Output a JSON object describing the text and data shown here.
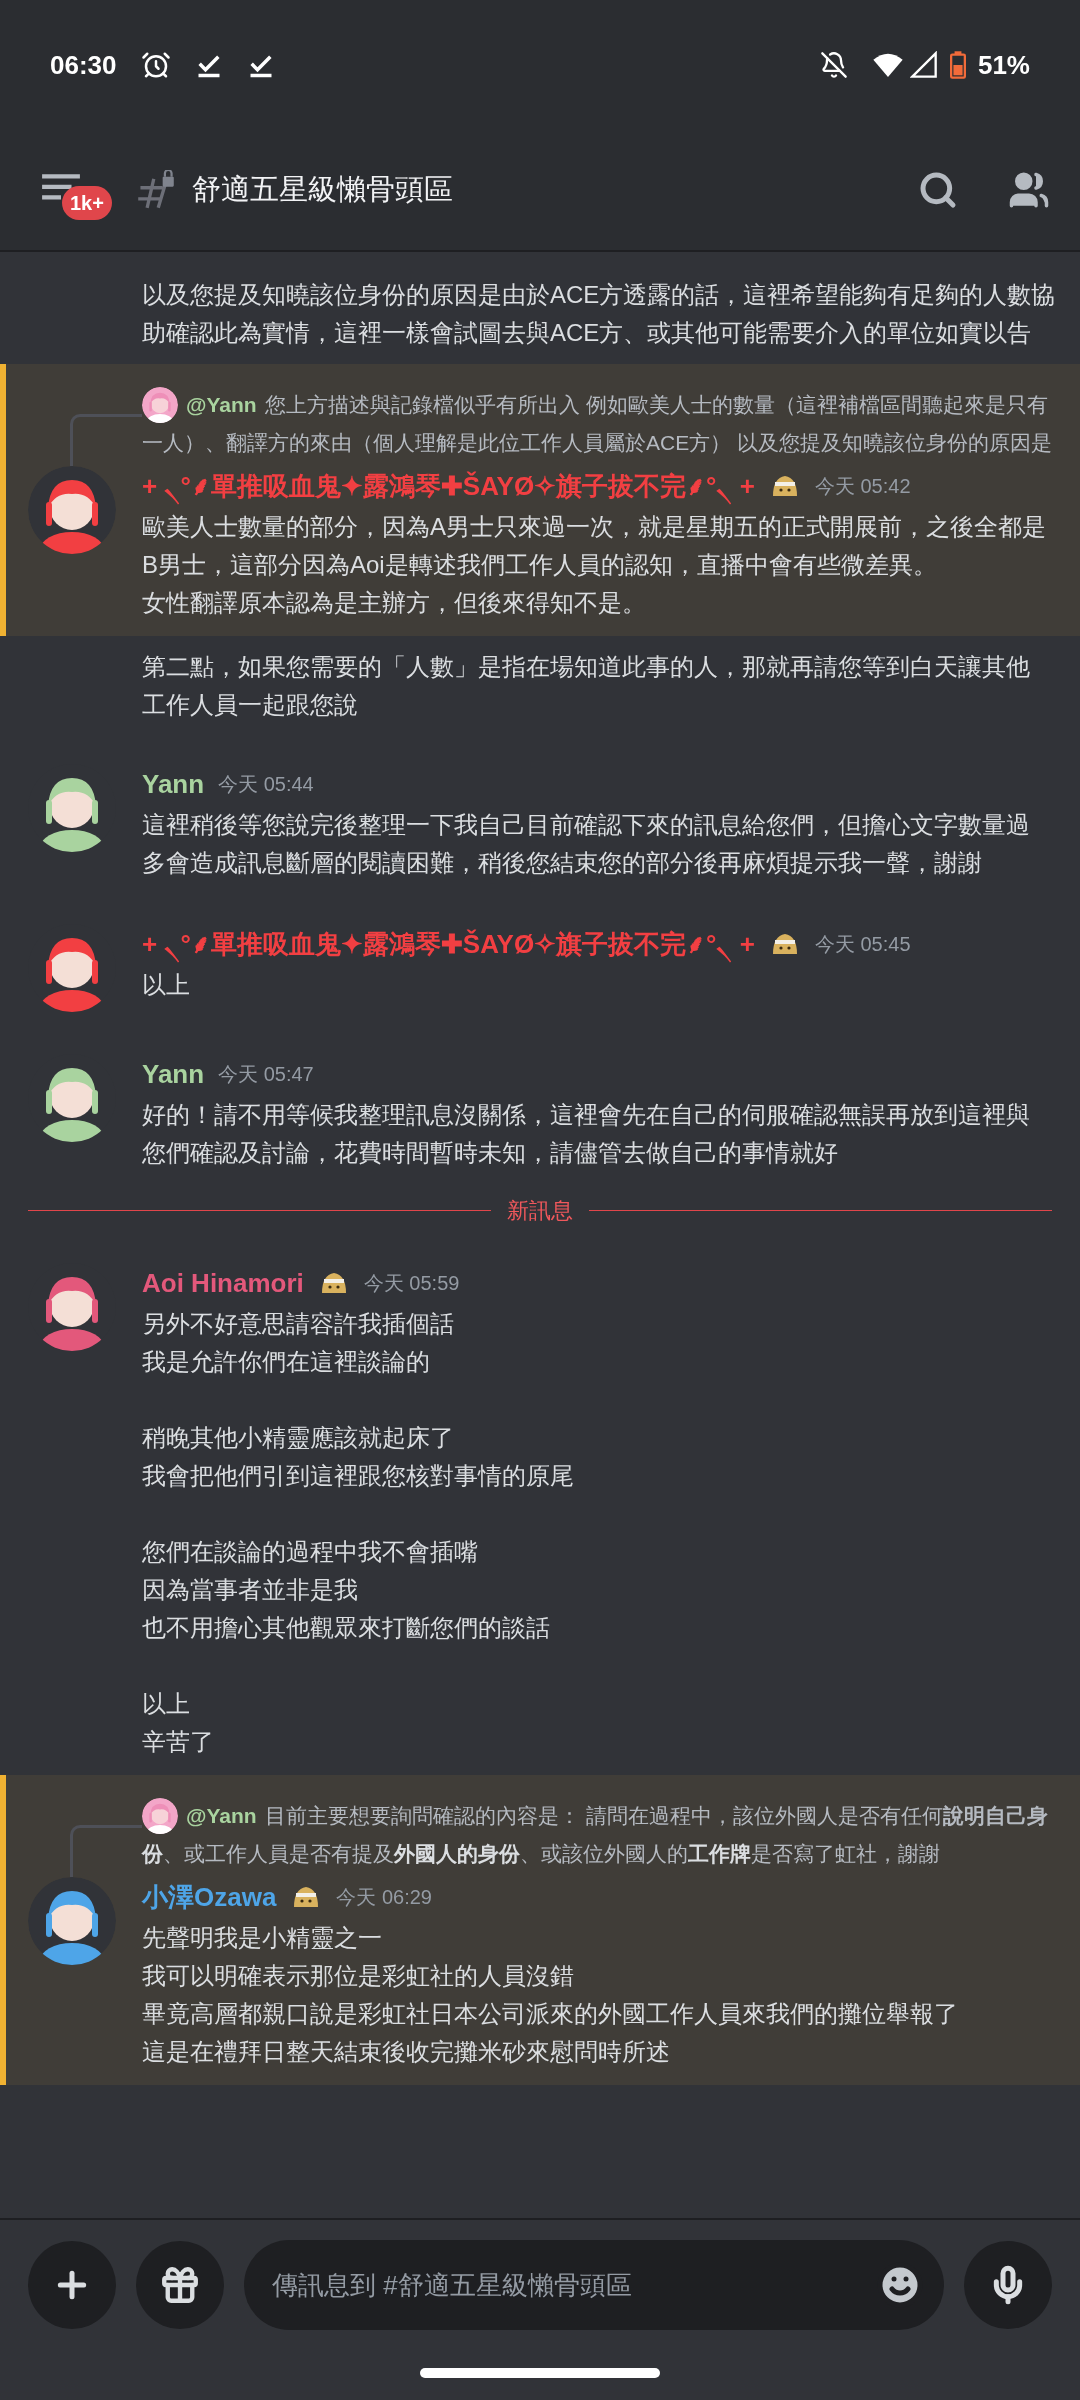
{
  "status_bar": {
    "time": "06:30",
    "battery": "51%"
  },
  "header": {
    "badge": "1k+",
    "channel": "舒適五星級懶骨頭區"
  },
  "messages": [
    {
      "kind": "continuation",
      "mentioned": false,
      "paragraphs": [
        [
          "以及您提及知曉該位身份的原因是由於ACE方透露的話，這裡希望能夠有足夠的人數協",
          "助確認此為實情，這裡一樣會試圖去與ACE方、或其他可能需要介入的單位如實以告"
        ]
      ]
    },
    {
      "kind": "message",
      "mentioned": true,
      "reply": {
        "mention": "@Yann",
        "lines": [
          "您上方描述與記錄檔似乎有所出入 例如歐美人士的數量（這裡補檔區間聽起來是只有",
          "一人）、翻譯方的來由（個人理解是此位工作人員屬於ACE方） 以及您提及知曉該位身份的原因是"
        ]
      },
      "author": "+ ৲°⸙單推吸血鬼✦露鴻琴✚ŠAYØ✧旗子拔不完⸙°৲ +",
      "color": "#f23f42",
      "badge": true,
      "time": "今天 05:42",
      "paragraphs": [
        [
          "歐美人士數量的部分，因為A男士只來過一次，就是星期五的正式開展前，之後全都是",
          "B男士，這部分因為Aoi是轉述我們工作人員的認知，直播中會有些微差異。",
          "女性翻譯原本認為是主辦方，但後來得知不是。"
        ]
      ]
    },
    {
      "kind": "continuation",
      "mentioned": false,
      "paragraphs": [
        [
          "第二點，如果您需要的「人數」是指在場知道此事的人，那就再請您等到白天讓其他",
          "工作人員一起跟您說"
        ]
      ]
    },
    {
      "kind": "message",
      "mentioned": false,
      "author": "Yann",
      "color": "#a9d39f",
      "time": "今天 05:44",
      "paragraphs": [
        [
          "這裡稍後等您說完後整理一下我自己目前確認下來的訊息給您們，但擔心文字數量過",
          "多會造成訊息斷層的閱讀困難，稍後您結束您的部分後再麻煩提示我一聲，謝謝"
        ]
      ]
    },
    {
      "kind": "message",
      "mentioned": false,
      "author": "+ ৲°⸙單推吸血鬼✦露鴻琴✚ŠAYØ✧旗子拔不完⸙°৲ +",
      "color": "#f23f42",
      "badge": true,
      "time": "今天 05:45",
      "paragraphs": [
        [
          "以上"
        ]
      ]
    },
    {
      "kind": "message",
      "mentioned": false,
      "author": "Yann",
      "color": "#a9d39f",
      "time": "今天 05:47",
      "paragraphs": [
        [
          "好的！請不用等候我整理訊息沒關係，這裡會先在自己的伺服確認無誤再放到這裡與",
          "您們確認及討論，花費時間暫時未知，請儘管去做自己的事情就好"
        ]
      ]
    },
    {
      "kind": "divider",
      "label": "新訊息"
    },
    {
      "kind": "message",
      "mentioned": false,
      "author": "Aoi Hinamori",
      "color": "#e3587b",
      "badge": true,
      "time": "今天 05:59",
      "paragraphs": [
        [
          "另外不好意思請容許我插個話",
          "我是允許你們在這裡談論的"
        ],
        [
          "稍晚其他小精靈應該就起床了",
          "我會把他們引到這裡跟您核對事情的原尾"
        ],
        [
          "您們在談論的過程中我不會插嘴",
          "因為當事者並非是我",
          "也不用擔心其他觀眾來打斷您們的談話"
        ],
        [
          "以上",
          "辛苦了"
        ]
      ]
    },
    {
      "kind": "message",
      "mentioned": true,
      "reply": {
        "mention": "@Yann",
        "lines": [
          "目前主要想要詢問確認的內容是： 請問在過程中，該位外國人是否有任何**說明自己身**",
          "**份**、或工作人員是否有提及**外國人的身份**、或該位外國人的**工作牌**是否寫了虹社，謝謝"
        ]
      },
      "author": "小澤Ozawa",
      "color": "#4ea5e8",
      "badge": true,
      "time": "今天 06:29",
      "paragraphs": [
        [
          "先聲明我是小精靈之一",
          "我可以明確表示那位是彩虹社的人員沒錯",
          "畢竟高層都親口說是彩虹社日本公司派來的外國工作人員來我們的攤位舉報了",
          "這是在禮拜日整天結束後收完攤米砂來慰問時所述"
        ]
      ]
    }
  ],
  "composer": {
    "placeholder": "傳訊息到 #舒適五星級懶骨頭區"
  }
}
